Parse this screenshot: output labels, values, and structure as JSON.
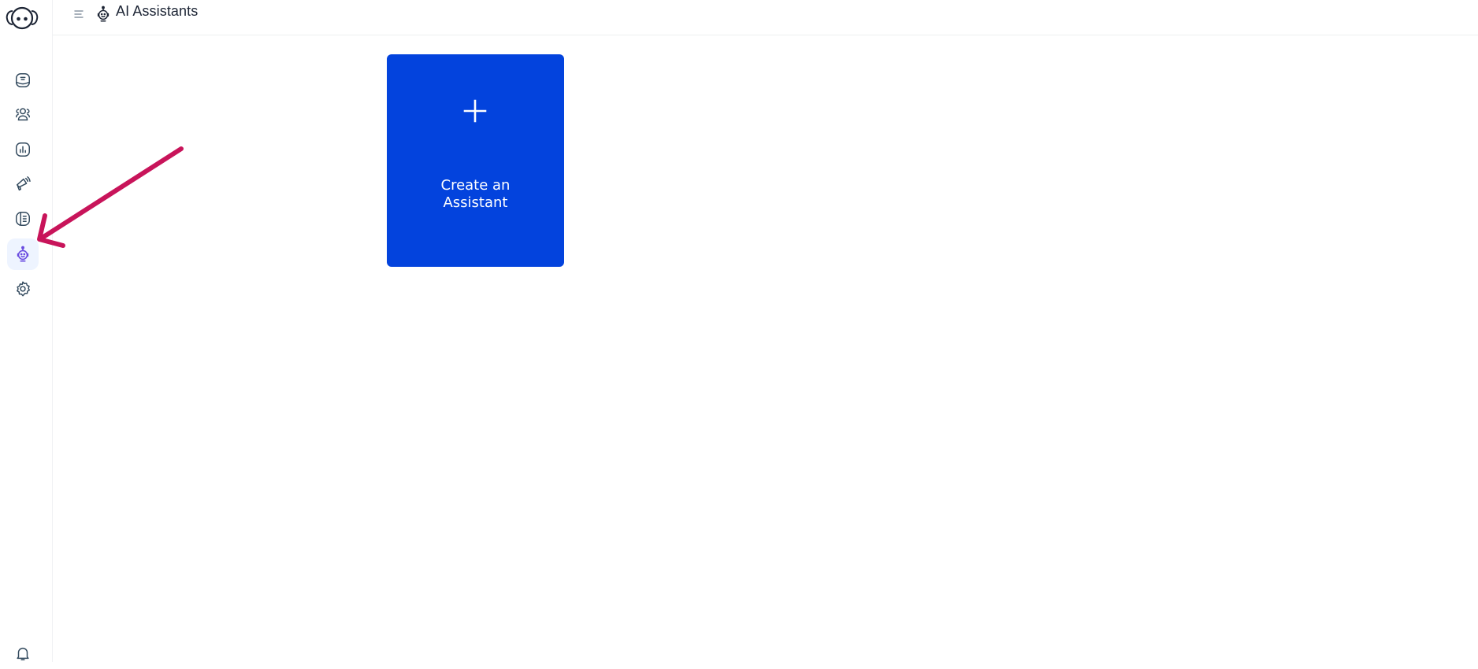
{
  "app": {
    "logo_icon": "elephant-face-logo"
  },
  "header": {
    "menu_icon": "menu-lines-icon",
    "title_icon": "robot-icon",
    "title": "AI Assistants"
  },
  "sidebar": {
    "items": [
      {
        "id": "inbox",
        "icon": "chat-inbox-icon",
        "active": false
      },
      {
        "id": "contacts",
        "icon": "users-icon",
        "active": false
      },
      {
        "id": "reports",
        "icon": "bar-chart-icon",
        "active": false
      },
      {
        "id": "campaigns",
        "icon": "megaphone-icon",
        "active": false
      },
      {
        "id": "help-center",
        "icon": "book-icon",
        "active": false
      },
      {
        "id": "ai-assistants",
        "icon": "robot-icon",
        "active": true
      },
      {
        "id": "settings",
        "icon": "gear-icon",
        "active": false
      }
    ],
    "bottom": {
      "id": "notifications",
      "icon": "bell-icon"
    }
  },
  "main": {
    "create_card": {
      "icon": "plus-icon",
      "label_line1": "Create an",
      "label_line2": "Assistant"
    }
  },
  "annotation": {
    "icon": "arrow-pointer",
    "color": "#c8145a"
  },
  "colors": {
    "accent": "#0343dd",
    "active_bg": "#eef4ff",
    "active_icon": "#6a4ce0",
    "icon": "#334a5e"
  }
}
